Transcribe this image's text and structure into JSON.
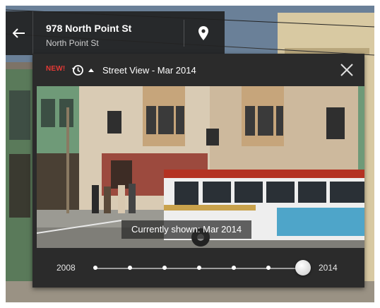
{
  "address": {
    "title": "978 North Point St",
    "subtitle": "North Point St",
    "back_icon": "arrow-left-icon",
    "pin_icon": "location-pin-icon"
  },
  "time_panel": {
    "badge": "NEW!",
    "history_icon": "history-icon",
    "title": "Street View - Mar 2014",
    "close_icon": "close-icon",
    "current_label": "Currently shown: Mar 2014",
    "slider": {
      "start_label": "2008",
      "end_label": "2014",
      "tick_count": 7,
      "selected_fraction": 1.0
    }
  },
  "colors": {
    "panel_bg": "#2b2b2b",
    "badge_red": "#e53935",
    "text": "#ffffff"
  }
}
